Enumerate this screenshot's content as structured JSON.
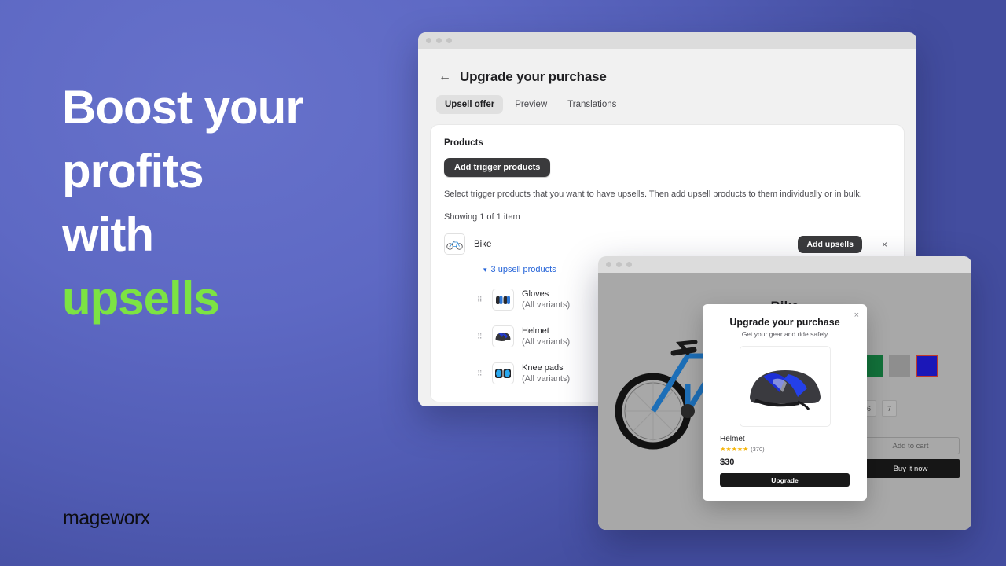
{
  "theme": {
    "background_start": "#6772cb",
    "background_end": "#3d4792",
    "accent_green": "#7ce343",
    "link_blue": "#2463d8",
    "dark_button": "#3a3a3c"
  },
  "marketing": {
    "headline_line1": "Boost your",
    "headline_line2": "profits",
    "headline_line3": "with",
    "headline_accent": "upsells",
    "logo": "mageworx"
  },
  "admin_window": {
    "back_arrow": "←",
    "page_title": "Upgrade your purchase",
    "tabs": [
      {
        "label": "Upsell offer",
        "active": true
      },
      {
        "label": "Preview",
        "active": false
      },
      {
        "label": "Translations",
        "active": false
      }
    ],
    "card": {
      "title": "Products",
      "add_trigger_button": "Add trigger products",
      "helper_text": "Select trigger products that you want to have upsells. Then add upsell products to them individually or in bulk.",
      "count_text": "Showing 1 of 1 item",
      "trigger_product": {
        "name": "Bike",
        "add_upsells_button": "Add upsells",
        "remove_label": "×"
      },
      "upsell_toggle": {
        "chevron": "▾",
        "label": "3 upsell products"
      },
      "upsell_products": [
        {
          "name": "Gloves",
          "variants": "(All variants)"
        },
        {
          "name": "Helmet",
          "variants": "(All variants)"
        },
        {
          "name": "Knee pads",
          "variants": "(All variants)"
        }
      ]
    }
  },
  "storefront_window": {
    "product_title": "Bike",
    "swatches": [
      {
        "name": "green",
        "color": "#12713a",
        "selected": false
      },
      {
        "name": "gray",
        "color": "#8e8e8e",
        "selected": false
      },
      {
        "name": "blue",
        "color": "#1b17b8",
        "selected": true
      }
    ],
    "sizes": [
      "6",
      "7"
    ],
    "add_to_cart_label": "Add to cart",
    "buy_now_label": "Buy it now"
  },
  "upsell_modal": {
    "close_label": "×",
    "title": "Upgrade your purchase",
    "subtitle": "Get your gear and ride safely",
    "product_name": "Helmet",
    "stars": "★★★★★",
    "review_count": "(370)",
    "price": "$30",
    "cta_label": "Upgrade"
  }
}
